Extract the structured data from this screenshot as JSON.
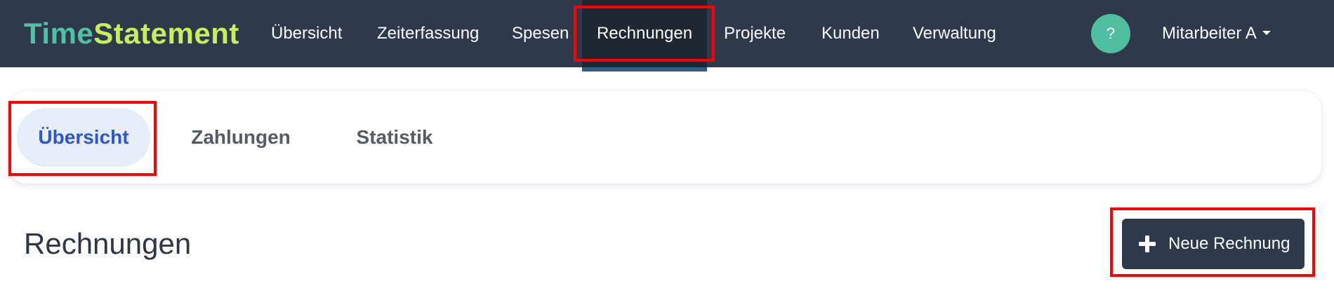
{
  "app": {
    "logo_part1": "Time",
    "logo_part2": "Statement"
  },
  "navbar": {
    "items": [
      {
        "label": "Übersicht"
      },
      {
        "label": "Zeiterfassung"
      },
      {
        "label": "Spesen"
      },
      {
        "label": "Rechnungen",
        "active": true
      },
      {
        "label": "Projekte"
      },
      {
        "label": "Kunden"
      },
      {
        "label": "Verwaltung"
      }
    ],
    "help_label": "?",
    "user_label": "Mitarbeiter A"
  },
  "subnav": {
    "tabs": [
      {
        "label": "Übersicht",
        "active": true
      },
      {
        "label": "Zahlungen"
      },
      {
        "label": "Statistik"
      }
    ]
  },
  "main": {
    "title": "Rechnungen",
    "new_button_label": "Neue Rechnung"
  },
  "colors": {
    "navbar_bg": "#2e3a4b",
    "accent_green": "#4fc3a1",
    "logo_lime": "#c5ef5c",
    "active_tab_text": "#2b57d1",
    "highlight": "#ff0000"
  }
}
